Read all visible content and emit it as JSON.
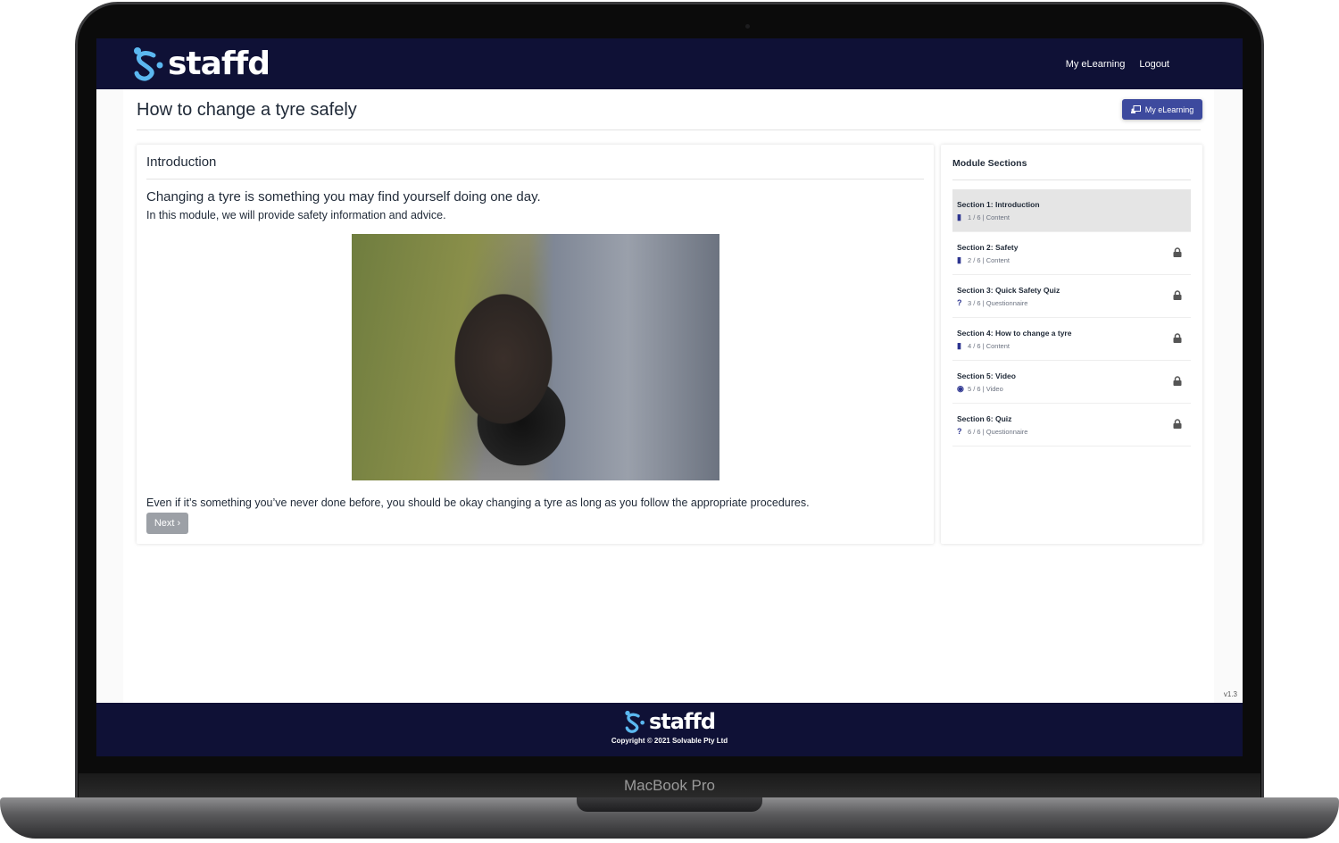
{
  "device": {
    "label": "MacBook Pro"
  },
  "brand": {
    "name": "staffd",
    "color": "#0f1136",
    "accent": "#3d4a9e",
    "logo_color": "#5bb8f0"
  },
  "nav": {
    "links": [
      "My eLearning",
      "Logout"
    ]
  },
  "page": {
    "title": "How to change a tyre safely",
    "my_elearning_button": "My eLearning"
  },
  "content": {
    "card_title": "Introduction",
    "heading": "Changing a tyre is something you may find yourself doing one day.",
    "intro": "In this module, we will provide safety information and advice.",
    "body": "Even if it’s something you’ve never done before, you should be okay changing a tyre as long as you follow the appropriate procedures.",
    "next_label": "Next"
  },
  "sidebar": {
    "title": "Module Sections",
    "items": [
      {
        "title": "Section 1: Introduction",
        "meta": "1 / 6 | Content",
        "icon": "file-icon",
        "locked": false,
        "active": true
      },
      {
        "title": "Section 2: Safety",
        "meta": "2 / 6 | Content",
        "icon": "file-icon",
        "locked": true
      },
      {
        "title": "Section 3: Quick Safety Quiz",
        "meta": "3 / 6 | Questionnaire",
        "icon": "question-icon",
        "locked": true
      },
      {
        "title": "Section 4: How to change a tyre",
        "meta": "4 / 6 | Content",
        "icon": "file-icon",
        "locked": true
      },
      {
        "title": "Section 5: Video",
        "meta": "5 / 6 | Video",
        "icon": "play-icon",
        "locked": true
      },
      {
        "title": "Section 6: Quiz",
        "meta": "6 / 6 | Questionnaire",
        "icon": "question-icon",
        "locked": true
      }
    ]
  },
  "version": "v1.3",
  "footer": {
    "copyright": "Copyright © 2021 Solvable Pty Ltd"
  }
}
